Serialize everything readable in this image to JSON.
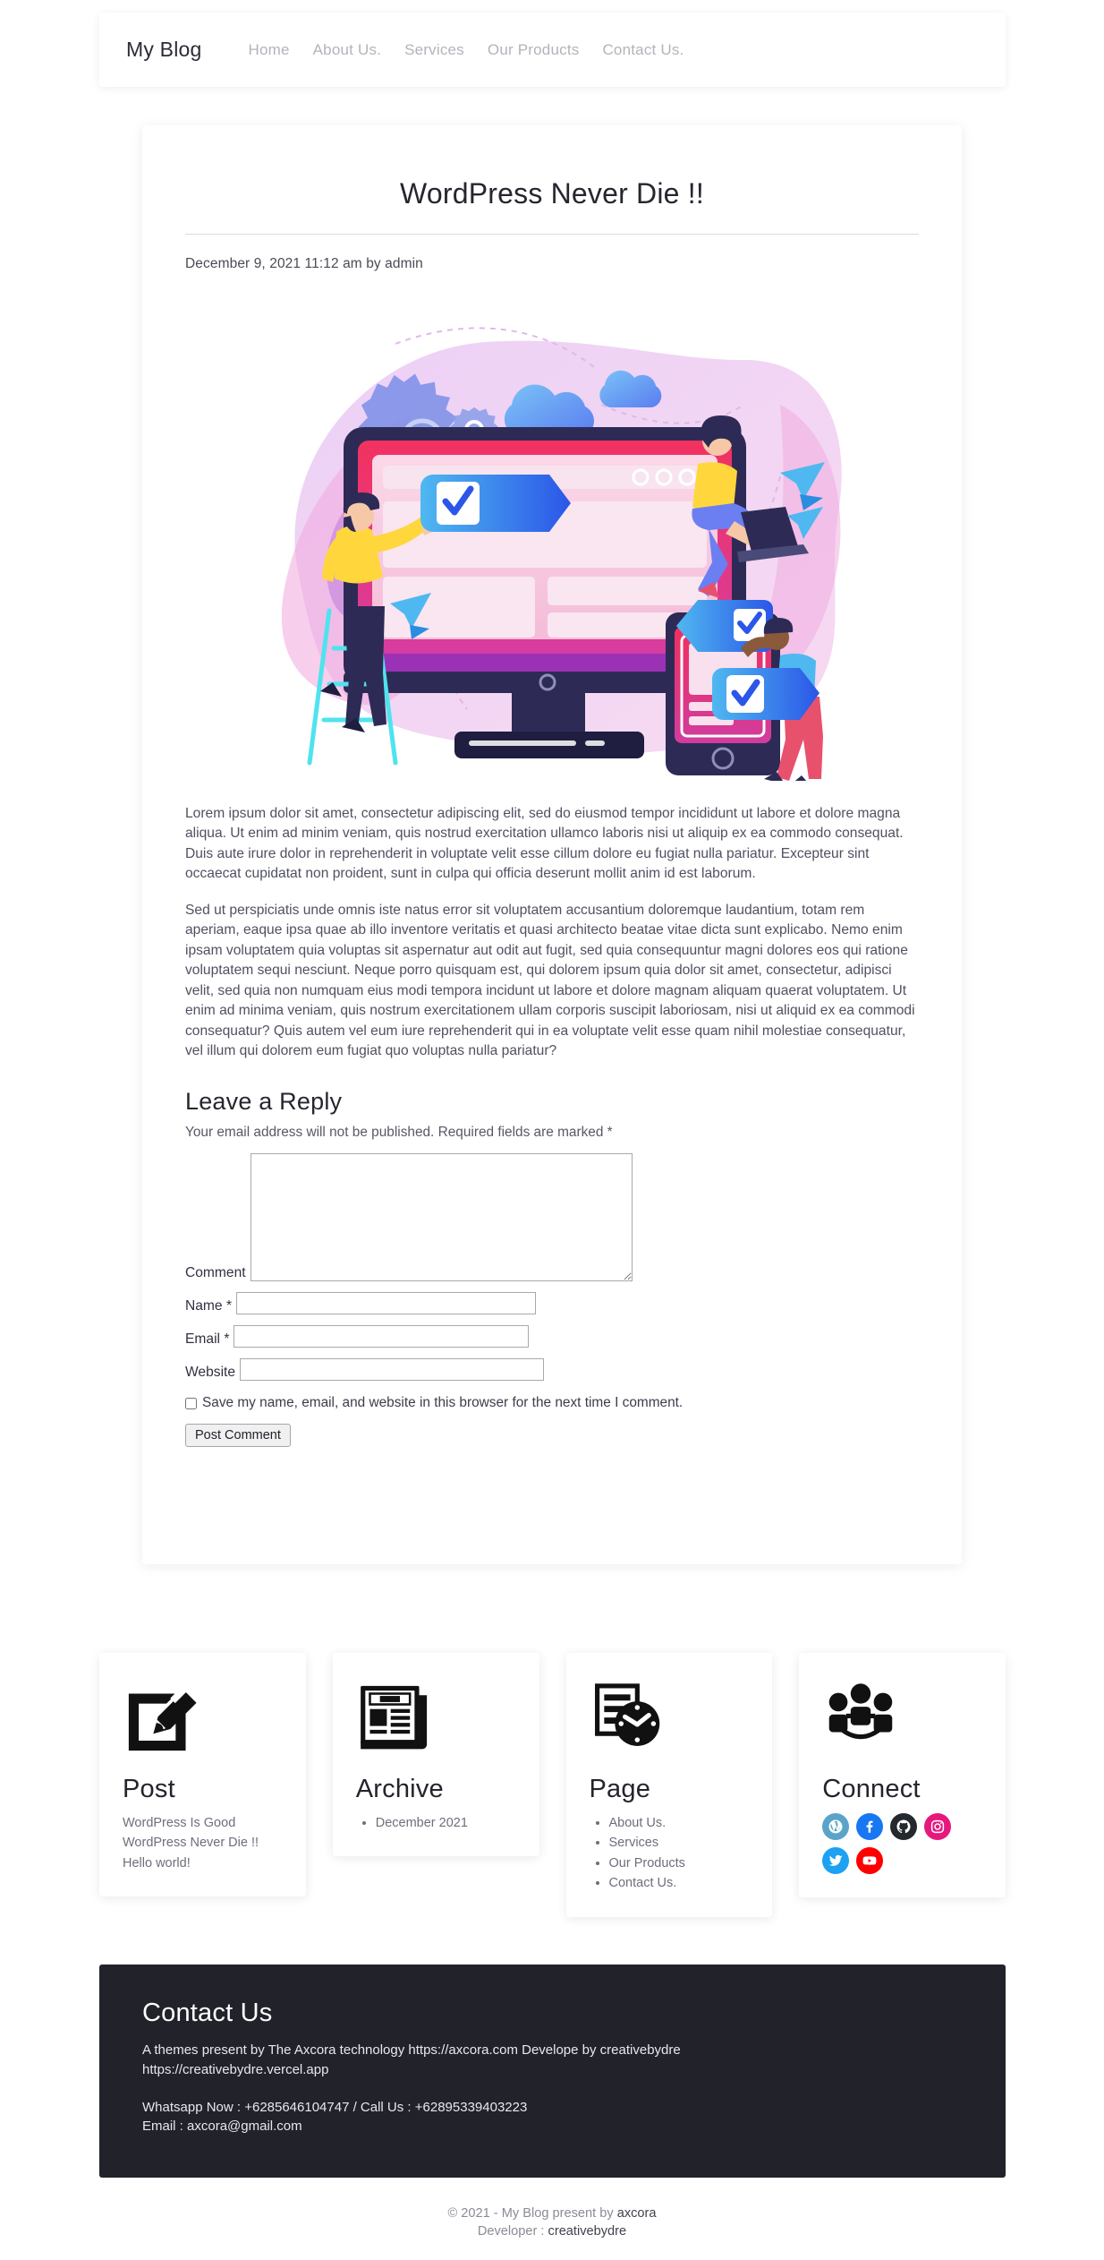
{
  "navbar": {
    "brand": "My Blog",
    "links": [
      {
        "label": "Home",
        "name": "nav-link-home"
      },
      {
        "label": "About Us.",
        "name": "nav-link-about"
      },
      {
        "label": "Services",
        "name": "nav-link-services"
      },
      {
        "label": "Our Products",
        "name": "nav-link-products"
      },
      {
        "label": "Contact Us.",
        "name": "nav-link-contact"
      }
    ]
  },
  "article": {
    "title": "WordPress Never Die !!",
    "meta": "December 9, 2021 11:12 am by admin",
    "hero_alt": "cross-platform web development illustration",
    "paragraph1": "Lorem ipsum dolor sit amet, consectetur adipiscing elit, sed do eiusmod tempor incididunt ut labore et dolore magna aliqua. Ut enim ad minim veniam, quis nostrud exercitation ullamco laboris nisi ut aliquip ex ea commodo consequat. Duis aute irure dolor in reprehenderit in voluptate velit esse cillum dolore eu fugiat nulla pariatur. Excepteur sint occaecat cupidatat non proident, sunt in culpa qui officia deserunt mollit anim id est laborum.",
    "paragraph2": "Sed ut perspiciatis unde omnis iste natus error sit voluptatem accusantium doloremque laudantium, totam rem aperiam, eaque ipsa quae ab illo inventore veritatis et quasi architecto beatae vitae dicta sunt explicabo. Nemo enim ipsam voluptatem quia voluptas sit aspernatur aut odit aut fugit, sed quia consequuntur magni dolores eos qui ratione voluptatem sequi nesciunt. Neque porro quisquam est, qui dolorem ipsum quia dolor sit amet, consectetur, adipisci velit, sed quia non numquam eius modi tempora incidunt ut labore et dolore magnam aliquam quaerat voluptatem. Ut enim ad minima veniam, quis nostrum exercitationem ullam corporis suscipit laboriosam, nisi ut aliquid ex ea commodi consequatur? Quis autem vel eum iure reprehenderit qui in ea voluptate velit esse quam nihil molestiae consequatur, vel illum qui dolorem eum fugiat quo voluptas nulla pariatur?"
  },
  "comment_form": {
    "heading": "Leave a Reply",
    "note": "Your email address will not be published. Required fields are marked *",
    "comment_label": "Comment",
    "comment_value": "",
    "name_label": "Name",
    "name_required": "*",
    "name_value": "",
    "email_label": "Email",
    "email_required": "*",
    "email_value": "",
    "website_label": "Website",
    "website_value": "",
    "save_label": "Save my name, email, and website in this browser for the next time I comment.",
    "save_checked": false,
    "submit_label": "Post Comment"
  },
  "widgets": [
    {
      "title": "Post",
      "icon": "pen-square-icon",
      "lines": [
        "WordPress Is Good",
        "WordPress Never Die !!",
        "Hello world!"
      ],
      "items": []
    },
    {
      "title": "Archive",
      "icon": "newspaper-icon",
      "lines": [],
      "items": [
        "December 2021"
      ]
    },
    {
      "title": "Page",
      "icon": "page-clock-icon",
      "lines": [],
      "items": [
        "About Us.",
        "Services",
        "Our Products",
        "Contact Us."
      ]
    },
    {
      "title": "Connect",
      "icon": "people-group-icon",
      "lines": [],
      "items": [],
      "socials": [
        {
          "name": "wordpress-icon",
          "label": "WordPress",
          "color": "#5aa4c8"
        },
        {
          "name": "facebook-icon",
          "label": "Facebook",
          "color": "#1877f2"
        },
        {
          "name": "github-icon",
          "label": "GitHub",
          "color": "#24292e"
        },
        {
          "name": "instagram-icon",
          "label": "Instagram",
          "color": "#e6187e"
        },
        {
          "name": "twitter-icon",
          "label": "Twitter",
          "color": "#1da1f2"
        },
        {
          "name": "youtube-icon",
          "label": "YouTube",
          "color": "#ff0000"
        }
      ]
    }
  ],
  "contact": {
    "title": "Contact Us",
    "about_line1": "A themes present by The Axcora technology https://axcora.com Develope by creativebydre",
    "about_line2": "https://creativebydre.vercel.app",
    "phone_line": "Whatsapp Now : +6285646104747 / Call Us : +62895339403223",
    "email_line": "Email : axcora@gmail.com"
  },
  "copyright": {
    "line1_pre": "© 2021 - My Blog present by ",
    "line1_strong": "axcora",
    "line2_pre": "Developer : ",
    "line2_strong": "creativebydre"
  },
  "colors": {
    "footer_bg": "#21222a",
    "nav_link": "#b3b3bb",
    "heading": "#26262f"
  }
}
